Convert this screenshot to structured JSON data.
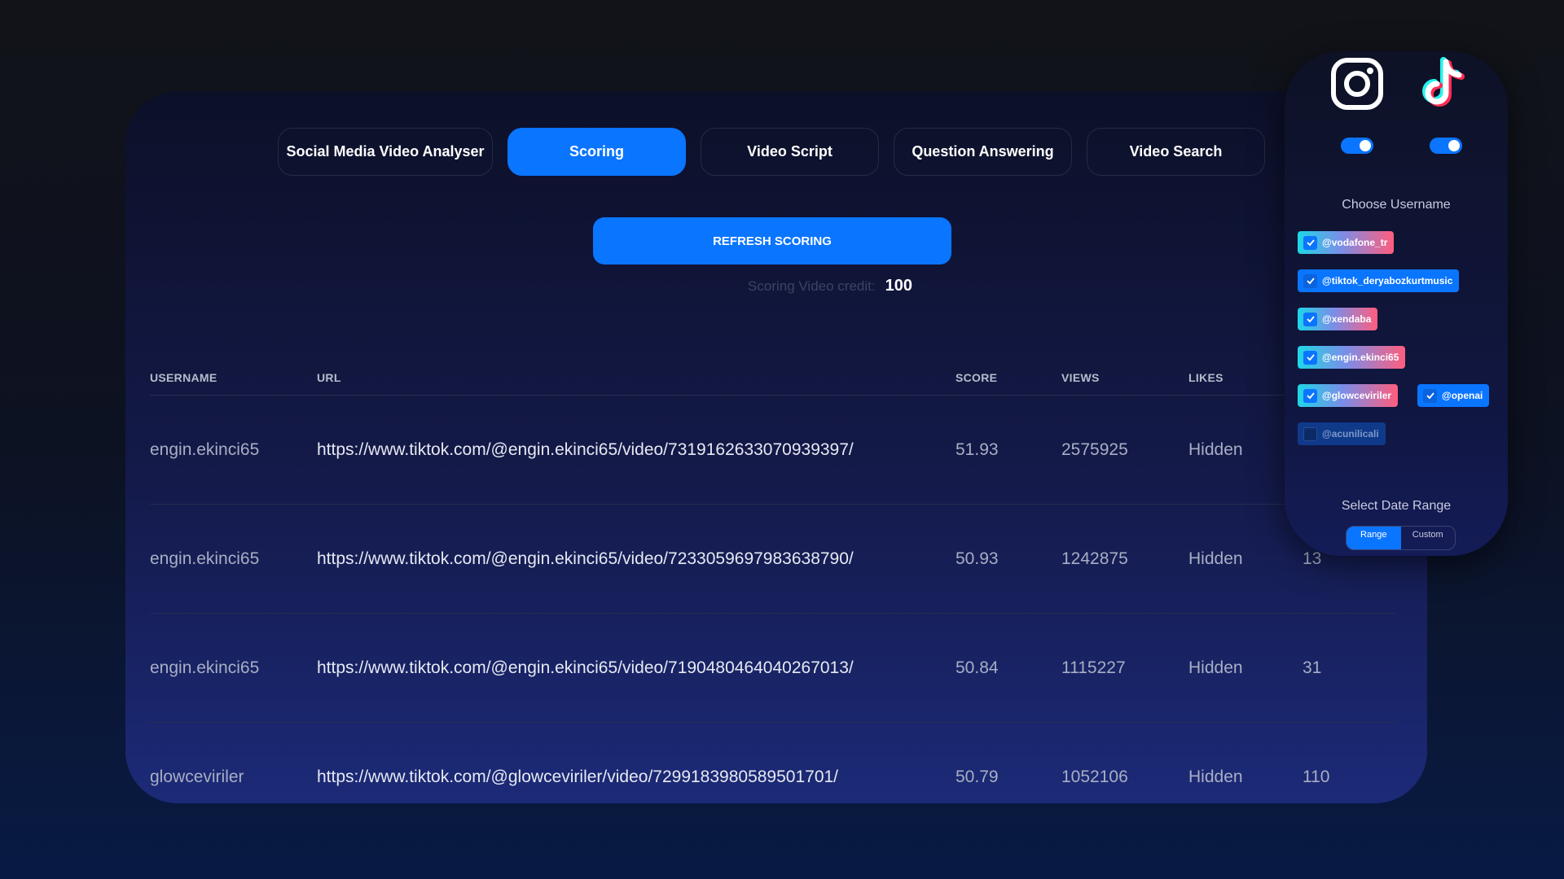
{
  "tabs": [
    {
      "label": "Social Media Video Analyser",
      "active": false
    },
    {
      "label": "Scoring",
      "active": true
    },
    {
      "label": "Video Script",
      "active": false
    },
    {
      "label": "Question Answering",
      "active": false
    },
    {
      "label": "Video Search",
      "active": false
    }
  ],
  "refresh_button": "REFRESH SCORING",
  "credit": {
    "label": "Scoring Video credit:",
    "value": "100"
  },
  "table": {
    "headers": [
      "USERNAME",
      "URL",
      "SCORE",
      "VIEWS",
      "LIKES"
    ],
    "rows": [
      {
        "username": "engin.ekinci65",
        "url": "https://www.tiktok.com/@engin.ekinci65/video/7319162633070939397/",
        "score": "51.93",
        "views": "2575925",
        "likes": "Hidden",
        "extra": ""
      },
      {
        "username": "engin.ekinci65",
        "url": "https://www.tiktok.com/@engin.ekinci65/video/7233059697983638790/",
        "score": "50.93",
        "views": "1242875",
        "likes": "Hidden",
        "extra": "13"
      },
      {
        "username": "engin.ekinci65",
        "url": "https://www.tiktok.com/@engin.ekinci65/video/7190480464040267013/",
        "score": "50.84",
        "views": "1115227",
        "likes": "Hidden",
        "extra": "31"
      },
      {
        "username": "glowceviriler",
        "url": "https://www.tiktok.com/@glowceviriler/video/7299183980589501701/",
        "score": "50.79",
        "views": "1052106",
        "likes": "Hidden",
        "extra": "110"
      }
    ]
  },
  "side": {
    "platforms": [
      {
        "icon": "instagram-icon",
        "enabled": true
      },
      {
        "icon": "tiktok-icon",
        "enabled": true
      }
    ],
    "choose_username": "Choose Username",
    "usernames": [
      {
        "label": "@vodafone_tr",
        "checked": true,
        "style": "gradient"
      },
      {
        "label": "@tiktok_deryabozkurtmusic",
        "checked": true,
        "style": "blue"
      },
      {
        "label": "@xendaba",
        "checked": true,
        "style": "gradient"
      },
      {
        "label": "@engin.ekinci65",
        "checked": true,
        "style": "gradient"
      },
      {
        "label": "@glowceviriler",
        "checked": true,
        "style": "gradient"
      },
      {
        "label": "@openai",
        "checked": true,
        "style": "blue"
      },
      {
        "label": "@acunilicali",
        "checked": false,
        "style": "off"
      }
    ],
    "date_range_title": "Select Date Range",
    "date_options": [
      "Range",
      "Custom"
    ]
  },
  "colors": {
    "accent": "#0a75ff",
    "background": "#111318"
  }
}
